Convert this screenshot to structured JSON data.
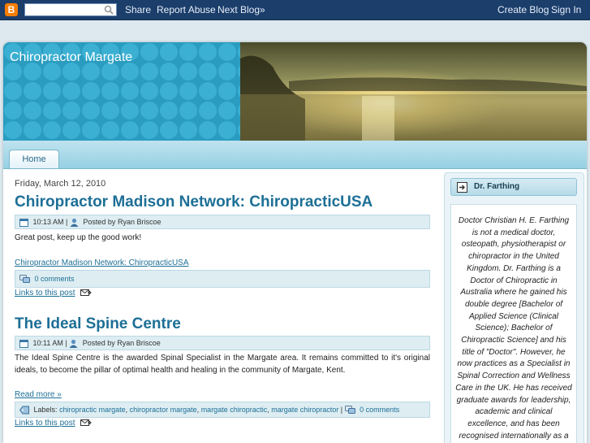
{
  "navbar": {
    "logo": "B",
    "search_placeholder": "",
    "links": [
      "Share",
      "Report Abuse",
      "Next Blog»"
    ],
    "right_links": [
      "Create Blog",
      "Sign In"
    ]
  },
  "header": {
    "title": "Chiropractor Margate"
  },
  "tabs": [
    {
      "label": "Home"
    }
  ],
  "posts": [
    {
      "date": "Friday, March 12, 2010",
      "title": "Chiropractor Madison Network: ChiropracticUSA",
      "time": "10:13 AM",
      "author_prefix": "Posted by",
      "author": "Ryan Briscoe",
      "body": "Great post, keep up the good work!",
      "body_link": "Chiropractor Madison Network: ChiropracticUSA",
      "comments": "0 comments",
      "links_to_post": "Links to this post"
    },
    {
      "title": "The Ideal Spine Centre",
      "time": "10:11 AM",
      "author_prefix": "Posted by",
      "author": "Ryan Briscoe",
      "body": "The Ideal Spine Centre is the awarded Spinal Specialist in the Margate area. It remains committed to it's original ideals, to become the pillar of optimal health and healing in the community of Margate, Kent.",
      "read_more": "Read more »",
      "labels_prefix": "Labels:",
      "labels": [
        "chiropractic margate",
        "chiropractor margate",
        "margate chiropractic",
        "margate chiropractor"
      ],
      "comments": "0 comments",
      "links_to_post": "Links to this post"
    }
  ],
  "sidebar": {
    "title": "Dr. Farthing",
    "text": "Doctor Christian H. E. Farthing is not a medical doctor, osteopath, physiotherapist or chiropractor in the United Kingdom. Dr. Farthing is a Doctor of Chiropractic in Australia where he gained his double degree [Bachelor of Applied Science (Clinical Science); Bachelor of Chiropractic Science] and his title of \"Doctor\". However, he now practices as a Specialist in Spinal Correction and Wellness Care in the UK. He has received graduate awards for leadership, academic and clinical excellence, and has been recognised internationally as a Distinguished Fellow of CBP for Clinical and Spinal Biomechanics. Dr. Farthing is a"
  },
  "colors": {
    "navbar": "#1b3e6b",
    "accent": "#1d6f96",
    "header": "#2fa5c8"
  }
}
